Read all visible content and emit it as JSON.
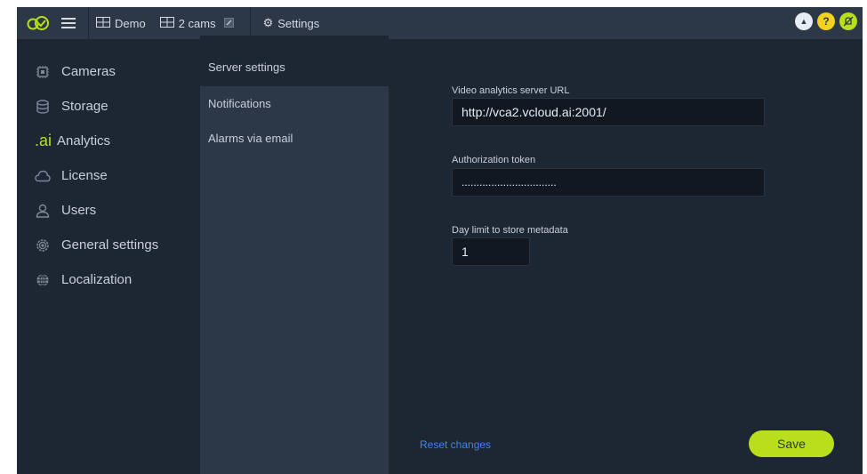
{
  "topbar": {
    "workspace": "Demo",
    "cams": "2 cams",
    "settings": "Settings"
  },
  "sidebar": {
    "items": [
      {
        "label": "Cameras",
        "icon": "camera-chip-icon"
      },
      {
        "label": "Storage",
        "icon": "database-icon"
      },
      {
        "label": "Analytics",
        "icon": "ai-icon"
      },
      {
        "label": "License",
        "icon": "cloud-icon"
      },
      {
        "label": "Users",
        "icon": "user-icon"
      },
      {
        "label": "General settings",
        "icon": "gear-icon"
      },
      {
        "label": "Localization",
        "icon": "globe-icon"
      }
    ]
  },
  "submenu": {
    "items": [
      "Server settings",
      "Notifications",
      "Alarms via email"
    ]
  },
  "form": {
    "url_label": "Video analytics server URL",
    "url_value": "http://vca2.vcloud.ai:2001/",
    "token_label": "Authorization token",
    "token_value": "................................",
    "limit_label": "Day limit to store metadata",
    "limit_value": "1"
  },
  "actions": {
    "reset": "Reset changes",
    "save": "Save"
  },
  "colors": {
    "accent": "#b9df1c",
    "link": "#3d86e6"
  }
}
